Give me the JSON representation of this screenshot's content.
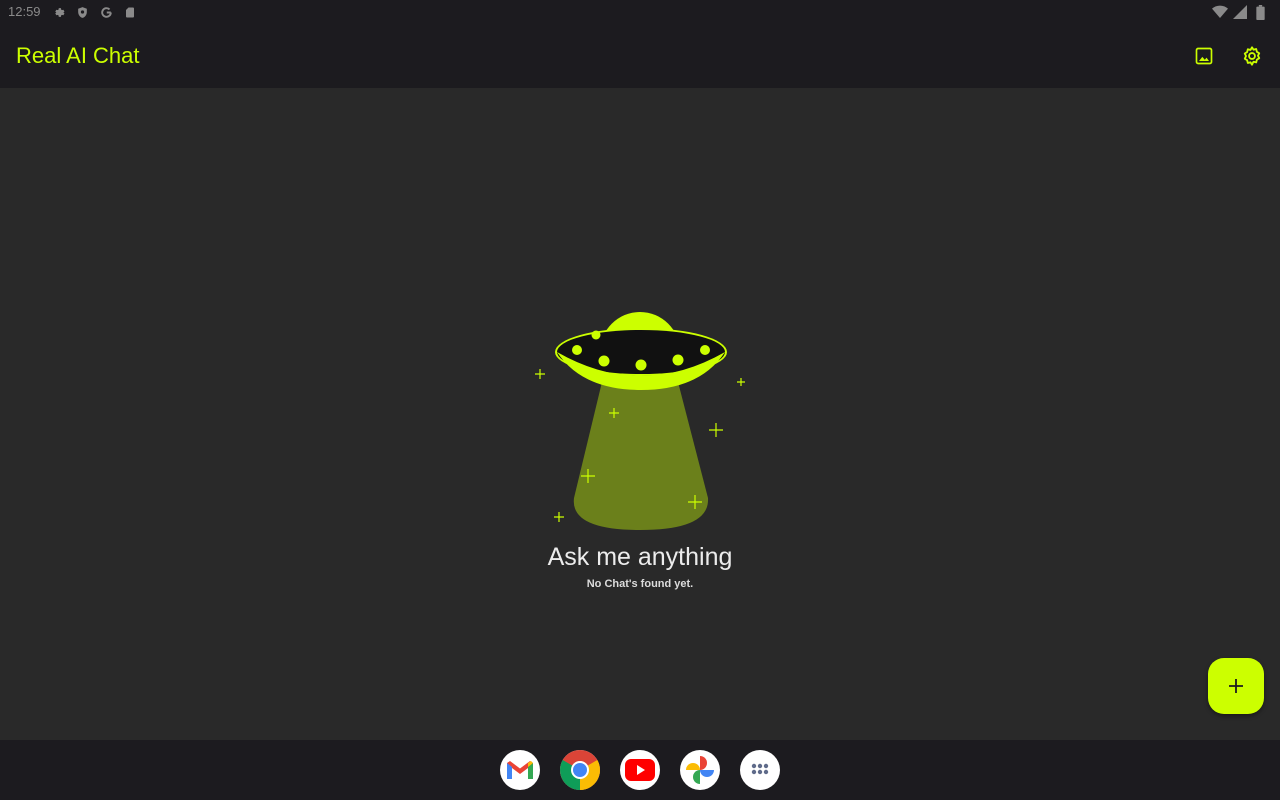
{
  "status_bar": {
    "time": "12:59",
    "left_icons": [
      "settings-icon",
      "shield-icon",
      "google-g-icon",
      "sd-card-icon"
    ],
    "right_icons": [
      "wifi-icon",
      "signal-icon",
      "battery-icon"
    ]
  },
  "app_bar": {
    "title": "Real AI Chat",
    "actions": [
      "image-icon",
      "gear-icon"
    ]
  },
  "empty_state": {
    "illustration": "ufo-illustration",
    "title": "Ask me anything",
    "subtitle": "No Chat's found yet."
  },
  "fab": {
    "icon": "plus-icon"
  },
  "dock": {
    "apps": [
      "gmail-icon",
      "chrome-icon",
      "youtube-icon",
      "google-photos-icon",
      "app-drawer-icon"
    ]
  },
  "colors": {
    "accent": "#ccff00",
    "app_bar_bg": "#1c1b1f",
    "content_bg": "#292929",
    "beam": "#6b801b",
    "title_text": "#ececec"
  }
}
